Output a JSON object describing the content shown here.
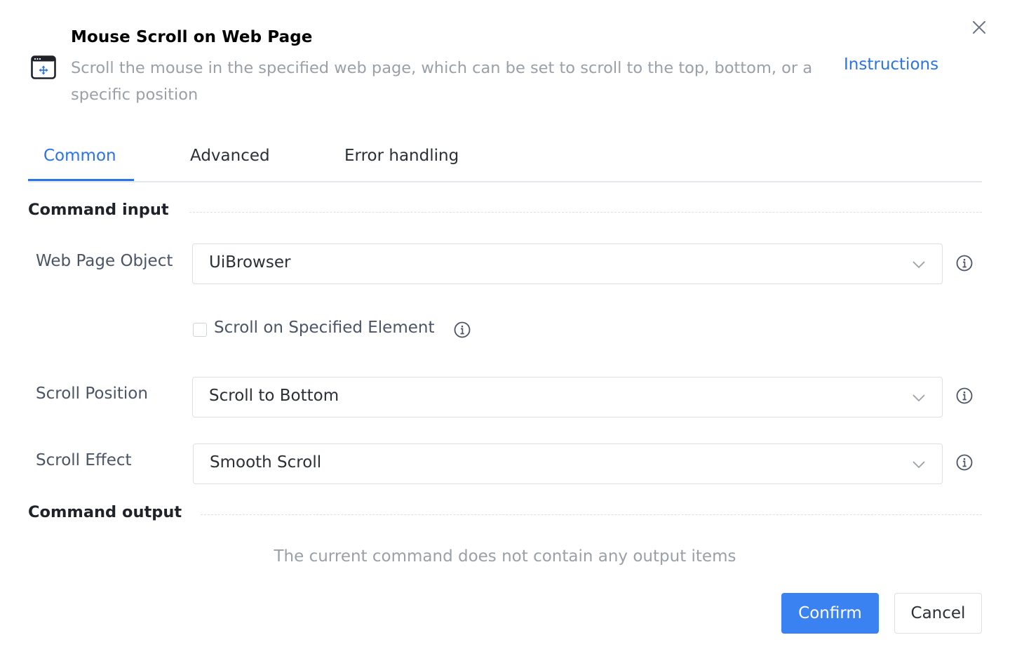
{
  "header": {
    "title": "Mouse Scroll on Web Page",
    "description": "Scroll the mouse in the specified web page, which can be set to scroll to the top, bottom, or a specific position",
    "instructions_link": "Instructions",
    "icon": "browser-window-move-icon",
    "close_icon": "close-icon"
  },
  "tabs": [
    {
      "label": "Common",
      "active": true
    },
    {
      "label": "Advanced",
      "active": false
    },
    {
      "label": "Error handling",
      "active": false
    }
  ],
  "command_input": {
    "section_title": "Command input",
    "web_page_object": {
      "label": "Web Page Object",
      "value": "UiBrowser"
    },
    "scroll_on_element": {
      "label": "Scroll on Specified Element",
      "checked": false
    },
    "scroll_position": {
      "label": "Scroll Position",
      "value": "Scroll to Bottom"
    },
    "scroll_effect": {
      "label": "Scroll Effect",
      "value": "Smooth Scroll"
    }
  },
  "command_output": {
    "section_title": "Command output",
    "empty_message": "The current command does not contain any output items"
  },
  "footer": {
    "confirm_label": "Confirm",
    "cancel_label": "Cancel"
  },
  "colors": {
    "accent": "#2a73e8",
    "primary_button": "#3a82f2",
    "muted_text": "#9aa0a8",
    "label_text": "#4a5566"
  }
}
